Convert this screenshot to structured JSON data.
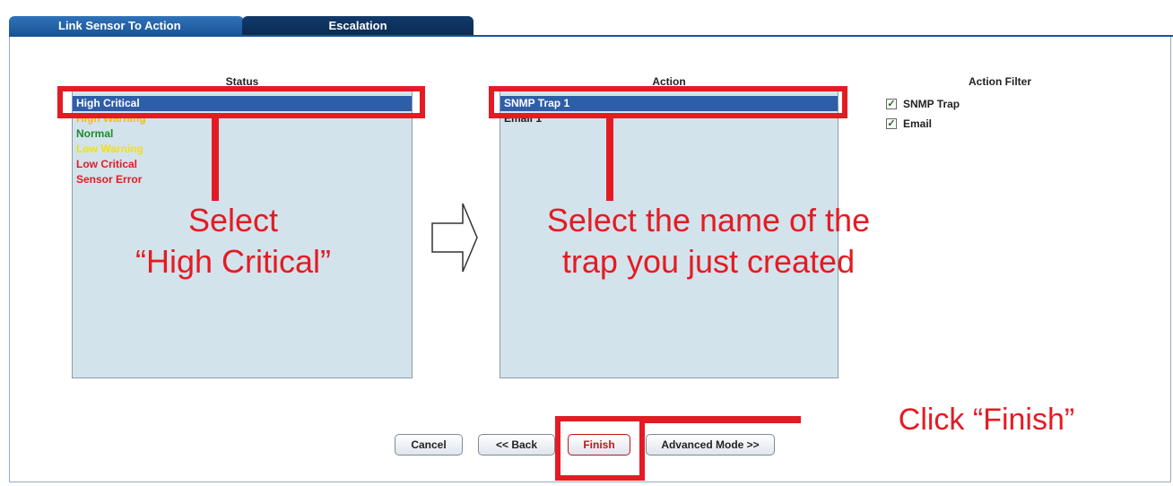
{
  "tabs": [
    {
      "label": "Link Sensor To Action"
    },
    {
      "label": "Escalation"
    }
  ],
  "status": {
    "heading": "Status",
    "items": [
      {
        "label": "High Critical",
        "color": "#ffffff"
      },
      {
        "label": "High Warning",
        "color": "#f2c200"
      },
      {
        "label": "Normal",
        "color": "#1f8a2a"
      },
      {
        "label": "Low Warning",
        "color": "#f2e200"
      },
      {
        "label": "Low Critical",
        "color": "#e41b23"
      },
      {
        "label": "Sensor Error",
        "color": "#e41b23"
      }
    ]
  },
  "action": {
    "heading": "Action",
    "items": [
      {
        "label": "SNMP Trap 1"
      },
      {
        "label": "Email 1"
      }
    ]
  },
  "action_filter": {
    "heading": "Action Filter",
    "options": [
      {
        "label": "SNMP Trap",
        "checked": true
      },
      {
        "label": "Email",
        "checked": true
      }
    ]
  },
  "buttons": {
    "cancel": "Cancel",
    "back": "<< Back",
    "finish": "Finish",
    "advanced": "Advanced Mode >>"
  },
  "annotations": {
    "select_status_line1": "Select",
    "select_status_line2": "“High Critical”",
    "select_action_line1": "Select the name of the",
    "select_action_line2": "trap you just created",
    "click_finish": "Click “Finish”"
  },
  "colors": {
    "annotation_red": "#e41b23",
    "selection_blue": "#2f5ea8",
    "list_bg": "#d3e3ec"
  }
}
